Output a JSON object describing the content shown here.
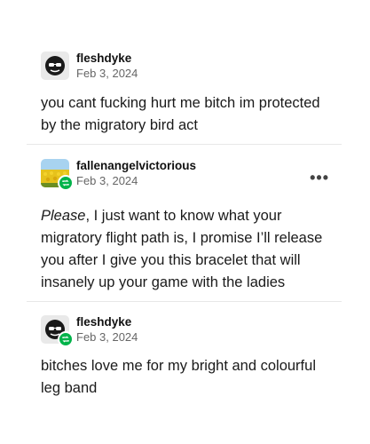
{
  "posts": [
    {
      "username": "fleshdyke",
      "date": "Feb 3, 2024",
      "body": "you cant fucking hurt me bitch im protected by the migratory bird act",
      "avatar": "sunglasses-face-icon",
      "reblog": false
    },
    {
      "username": "fallenangelvictorious",
      "date": "Feb 3, 2024",
      "body_emphasis": "Please",
      "body_rest": ", I just want to know what your migratory flight path is, I promise I’ll release you after I give you this bracelet that will insanely up your game with the ladies",
      "avatar": "sunflower-field-icon",
      "reblog": true,
      "more_label": "•••"
    },
    {
      "username": "fleshdyke",
      "date": "Feb 3, 2024",
      "body": "bitches love me for my bright and colourful leg band",
      "avatar": "sunglasses-face-icon",
      "reblog": true
    }
  ],
  "colors": {
    "reblog_badge": "#00b34a",
    "divider": "#e8e8e8",
    "date": "#666666"
  }
}
